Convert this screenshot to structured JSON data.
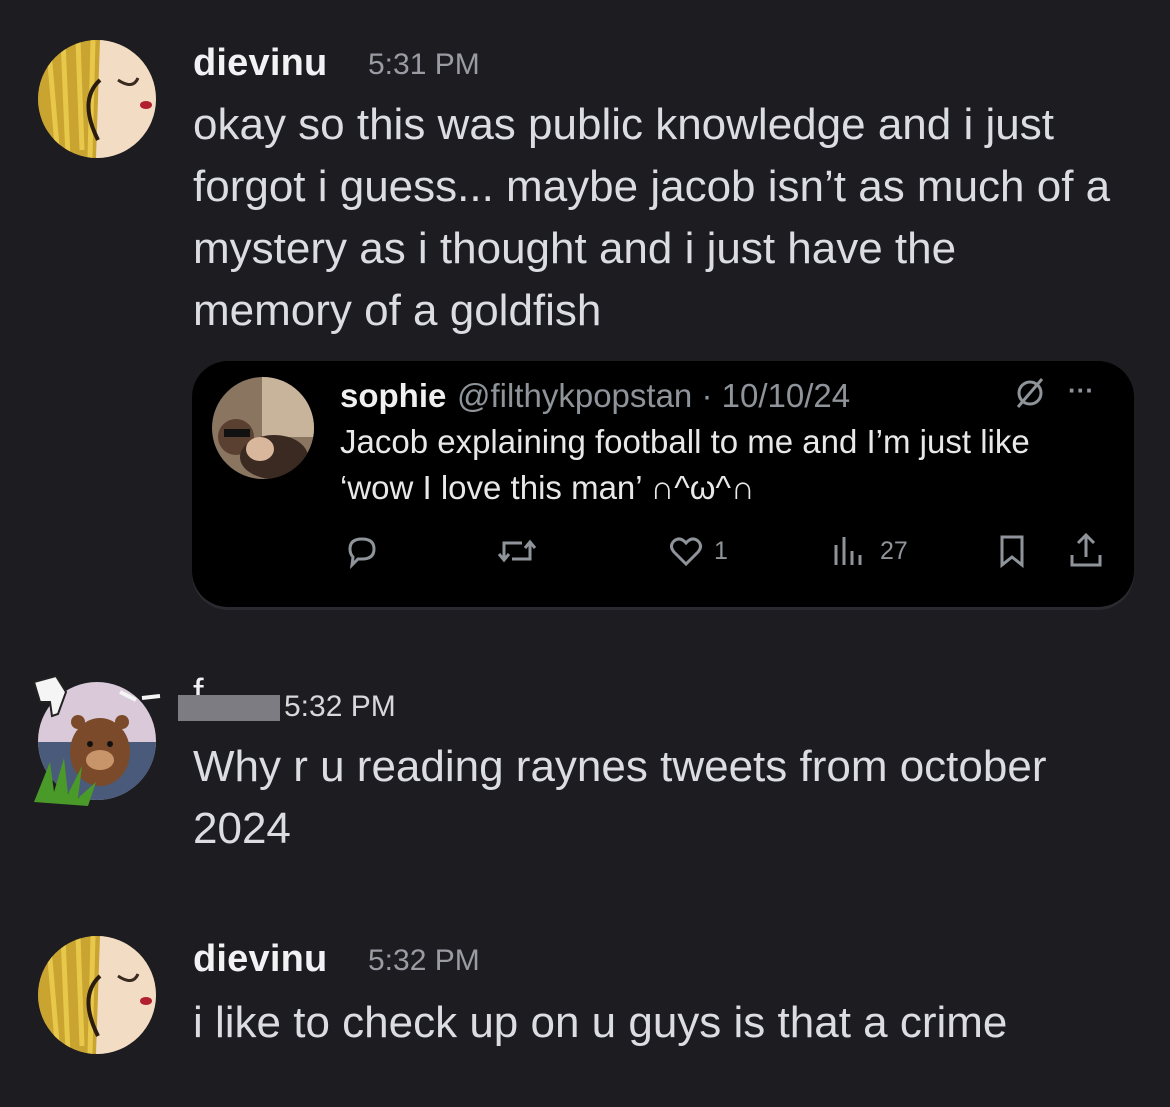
{
  "messages": [
    {
      "author": "dievinu",
      "time": "5:31 PM",
      "text": "okay so this was public knowledge and i just\nforgot i guess... maybe jacob isn’t as much of a\nmystery as i thought and i just have the\nmemory of a goldfish"
    },
    {
      "author": "f",
      "time": "5:32 PM",
      "text": "Why r u reading raynes tweets from october\n2024"
    },
    {
      "author": "dievinu",
      "time": "5:32 PM",
      "text": "i like to check up on u guys is that a crime"
    }
  ],
  "tweet": {
    "name": "sophie",
    "handle_date": "@filthykpopstan · 10/10/24",
    "text": "Jacob explaining football to me and I’m just like\n‘wow I love this man’ ∩^ω^∩",
    "likes": "1",
    "views": "27",
    "more": "···"
  },
  "colors": {
    "background": "#1c1c21",
    "tweet_bg": "#000000",
    "muted": "#8f949a"
  },
  "icons": [
    "reply-icon",
    "retweet-icon",
    "like-icon",
    "views-icon",
    "bookmark-icon",
    "share-icon",
    "grok-icon",
    "more-icon"
  ]
}
